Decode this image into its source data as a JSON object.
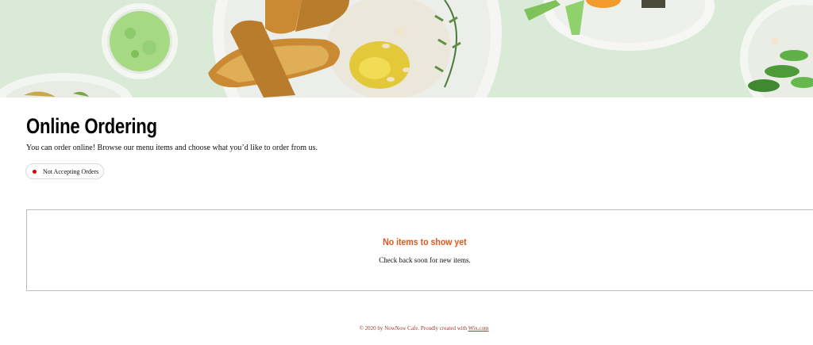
{
  "hero": {
    "image": "food-banner"
  },
  "page": {
    "title": "Online Ordering",
    "intro": "You can order online! Browse our menu items and choose what you’d like to order from us."
  },
  "status": {
    "label": "Not Accepting Orders",
    "color": "#d40000"
  },
  "empty_state": {
    "title": "No items to show yet",
    "subtitle": "Check back soon for new items."
  },
  "footer": {
    "text": "© 2020 by NowNow Cafe. Proudly created with ",
    "link": "Wix.com"
  },
  "colors": {
    "accent": "#e2561a",
    "hero_background": "#d9ead7",
    "footer_text": "#9a3b2d"
  }
}
